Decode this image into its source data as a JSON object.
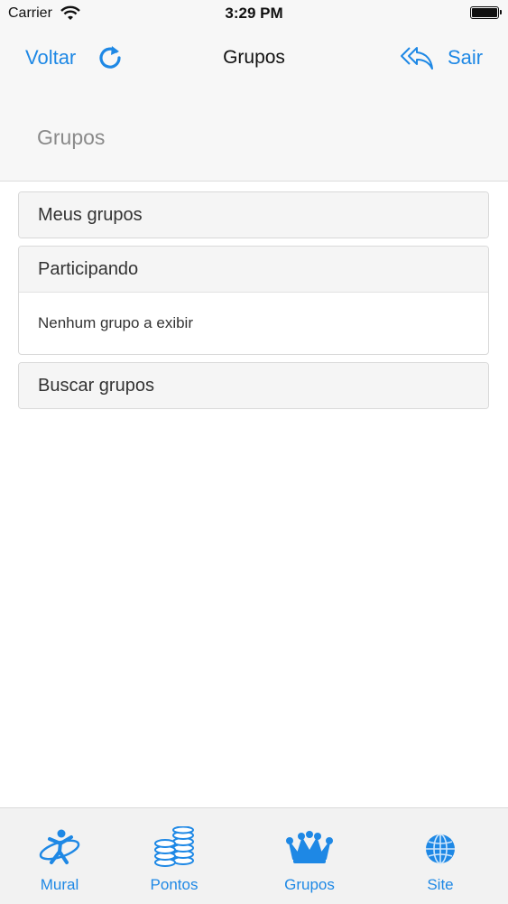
{
  "status_bar": {
    "carrier": "Carrier",
    "time": "3:29 PM"
  },
  "nav": {
    "back_label": "Voltar",
    "title": "Grupos",
    "exit_label": "Sair",
    "page_heading": "Grupos"
  },
  "panels": [
    {
      "title": "Meus grupos"
    },
    {
      "title": "Participando",
      "body": "Nenhum grupo a exibir"
    },
    {
      "title": "Buscar grupos"
    }
  ],
  "tabs": [
    {
      "label": "Mural",
      "icon": "mural-person-icon"
    },
    {
      "label": "Pontos",
      "icon": "coins-stack-icon"
    },
    {
      "label": "Grupos",
      "icon": "crown-icon"
    },
    {
      "label": "Site",
      "icon": "globe-icon"
    }
  ],
  "colors": {
    "accent": "#1e88e5",
    "bar_background": "#f7f7f7",
    "panel_heading": "#f5f5f5"
  }
}
